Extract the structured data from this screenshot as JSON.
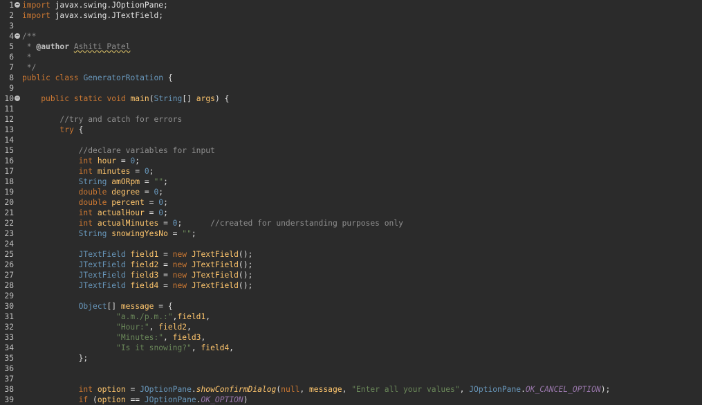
{
  "editor": {
    "folded_lines": [
      1,
      4,
      10
    ],
    "lines": [
      [
        [
          "kw",
          "import"
        ],
        [
          "txt",
          " javax.swing.JOptionPane;"
        ]
      ],
      [
        [
          "kw",
          "import"
        ],
        [
          "txt",
          " javax.swing.JTextField;"
        ]
      ],
      [],
      [
        [
          "cm",
          "/**"
        ]
      ],
      [
        [
          "cm",
          " * "
        ],
        [
          "tag",
          "@author"
        ],
        [
          "cm",
          " "
        ],
        [
          "auth",
          "Ashiti Patel"
        ]
      ],
      [
        [
          "cm",
          " *"
        ]
      ],
      [
        [
          "cm",
          " */"
        ]
      ],
      [
        [
          "kw",
          "public"
        ],
        [
          "txt",
          " "
        ],
        [
          "kw",
          "class"
        ],
        [
          "txt",
          " "
        ],
        [
          "cls",
          "GeneratorRotation"
        ],
        [
          "op",
          " {"
        ]
      ],
      [],
      [
        [
          "txt",
          "    "
        ],
        [
          "kw",
          "public"
        ],
        [
          "txt",
          " "
        ],
        [
          "kw",
          "static"
        ],
        [
          "txt",
          " "
        ],
        [
          "kw",
          "void"
        ],
        [
          "txt",
          " "
        ],
        [
          "id",
          "main"
        ],
        [
          "op",
          "("
        ],
        [
          "ty",
          "String"
        ],
        [
          "op",
          "[] "
        ],
        [
          "id",
          "args"
        ],
        [
          "op",
          ") {"
        ]
      ],
      [],
      [
        [
          "txt",
          "        "
        ],
        [
          "cm",
          "//try and catch for errors"
        ]
      ],
      [
        [
          "txt",
          "        "
        ],
        [
          "kw",
          "try"
        ],
        [
          "op",
          " {"
        ]
      ],
      [],
      [
        [
          "txt",
          "            "
        ],
        [
          "cm",
          "//declare variables for input"
        ]
      ],
      [
        [
          "txt",
          "            "
        ],
        [
          "kw",
          "int"
        ],
        [
          "txt",
          " "
        ],
        [
          "id",
          "hour"
        ],
        [
          "op",
          " = "
        ],
        [
          "num",
          "0"
        ],
        [
          "op",
          ";"
        ]
      ],
      [
        [
          "txt",
          "            "
        ],
        [
          "kw",
          "int"
        ],
        [
          "txt",
          " "
        ],
        [
          "id",
          "minutes"
        ],
        [
          "op",
          " = "
        ],
        [
          "num",
          "0"
        ],
        [
          "op",
          ";"
        ]
      ],
      [
        [
          "txt",
          "            "
        ],
        [
          "ty",
          "String"
        ],
        [
          "txt",
          " "
        ],
        [
          "id",
          "amORpm"
        ],
        [
          "op",
          " = "
        ],
        [
          "str",
          "\"\""
        ],
        [
          "op",
          ";"
        ]
      ],
      [
        [
          "txt",
          "            "
        ],
        [
          "kw",
          "double"
        ],
        [
          "txt",
          " "
        ],
        [
          "id",
          "degree"
        ],
        [
          "op",
          " = "
        ],
        [
          "num",
          "0"
        ],
        [
          "op",
          ";"
        ]
      ],
      [
        [
          "txt",
          "            "
        ],
        [
          "kw",
          "double"
        ],
        [
          "txt",
          " "
        ],
        [
          "id",
          "percent"
        ],
        [
          "op",
          " = "
        ],
        [
          "num",
          "0"
        ],
        [
          "op",
          ";"
        ]
      ],
      [
        [
          "txt",
          "            "
        ],
        [
          "kw",
          "int"
        ],
        [
          "txt",
          " "
        ],
        [
          "id",
          "actualHour"
        ],
        [
          "op",
          " = "
        ],
        [
          "num",
          "0"
        ],
        [
          "op",
          ";"
        ]
      ],
      [
        [
          "txt",
          "            "
        ],
        [
          "kw",
          "int"
        ],
        [
          "txt",
          " "
        ],
        [
          "id",
          "actualMinutes"
        ],
        [
          "op",
          " = "
        ],
        [
          "num",
          "0"
        ],
        [
          "op",
          ";"
        ],
        [
          "txt",
          "      "
        ],
        [
          "cm",
          "//created for understanding purposes only"
        ]
      ],
      [
        [
          "txt",
          "            "
        ],
        [
          "ty",
          "String"
        ],
        [
          "txt",
          " "
        ],
        [
          "id",
          "snowingYesNo"
        ],
        [
          "op",
          " = "
        ],
        [
          "str",
          "\"\""
        ],
        [
          "op",
          ";"
        ]
      ],
      [],
      [
        [
          "txt",
          "            "
        ],
        [
          "ty",
          "JTextField"
        ],
        [
          "txt",
          " "
        ],
        [
          "id",
          "field1"
        ],
        [
          "op",
          " = "
        ],
        [
          "kw",
          "new"
        ],
        [
          "txt",
          " "
        ],
        [
          "id",
          "JTextField"
        ],
        [
          "op",
          "();"
        ]
      ],
      [
        [
          "txt",
          "            "
        ],
        [
          "ty",
          "JTextField"
        ],
        [
          "txt",
          " "
        ],
        [
          "id",
          "field2"
        ],
        [
          "op",
          " = "
        ],
        [
          "kw",
          "new"
        ],
        [
          "txt",
          " "
        ],
        [
          "id",
          "JTextField"
        ],
        [
          "op",
          "();"
        ]
      ],
      [
        [
          "txt",
          "            "
        ],
        [
          "ty",
          "JTextField"
        ],
        [
          "txt",
          " "
        ],
        [
          "id",
          "field3"
        ],
        [
          "op",
          " = "
        ],
        [
          "kw",
          "new"
        ],
        [
          "txt",
          " "
        ],
        [
          "id",
          "JTextField"
        ],
        [
          "op",
          "();"
        ]
      ],
      [
        [
          "txt",
          "            "
        ],
        [
          "ty",
          "JTextField"
        ],
        [
          "txt",
          " "
        ],
        [
          "id",
          "field4"
        ],
        [
          "op",
          " = "
        ],
        [
          "kw",
          "new"
        ],
        [
          "txt",
          " "
        ],
        [
          "id",
          "JTextField"
        ],
        [
          "op",
          "();"
        ]
      ],
      [],
      [
        [
          "txt",
          "            "
        ],
        [
          "ty",
          "Object"
        ],
        [
          "op",
          "[] "
        ],
        [
          "id",
          "message"
        ],
        [
          "op",
          " = {"
        ]
      ],
      [
        [
          "txt",
          "                    "
        ],
        [
          "str",
          "\"a.m./p.m.:\""
        ],
        [
          "op",
          ","
        ],
        [
          "id",
          "field1"
        ],
        [
          "op",
          ","
        ]
      ],
      [
        [
          "txt",
          "                    "
        ],
        [
          "str",
          "\"Hour:\""
        ],
        [
          "op",
          ", "
        ],
        [
          "id",
          "field2"
        ],
        [
          "op",
          ","
        ]
      ],
      [
        [
          "txt",
          "                    "
        ],
        [
          "str",
          "\"Minutes:\""
        ],
        [
          "op",
          ", "
        ],
        [
          "id",
          "field3"
        ],
        [
          "op",
          ","
        ]
      ],
      [
        [
          "txt",
          "                    "
        ],
        [
          "str",
          "\"Is it snowing?\""
        ],
        [
          "op",
          ", "
        ],
        [
          "id",
          "field4"
        ],
        [
          "op",
          ","
        ]
      ],
      [
        [
          "txt",
          "            "
        ],
        [
          "op",
          "};"
        ]
      ],
      [],
      [],
      [
        [
          "txt",
          "            "
        ],
        [
          "kw",
          "int"
        ],
        [
          "txt",
          " "
        ],
        [
          "id",
          "option"
        ],
        [
          "op",
          " = "
        ],
        [
          "ty",
          "JOptionPane"
        ],
        [
          "op",
          "."
        ],
        [
          "mth",
          "showConfirmDialog"
        ],
        [
          "op",
          "("
        ],
        [
          "kw",
          "null"
        ],
        [
          "op",
          ", "
        ],
        [
          "id",
          "message"
        ],
        [
          "op",
          ", "
        ],
        [
          "str",
          "\"Enter all your values\""
        ],
        [
          "op",
          ", "
        ],
        [
          "ty",
          "JOptionPane"
        ],
        [
          "op",
          "."
        ],
        [
          "fld",
          "OK_CANCEL_OPTION"
        ],
        [
          "op",
          ");"
        ]
      ],
      [
        [
          "txt",
          "            "
        ],
        [
          "kw",
          "if"
        ],
        [
          "op",
          " ("
        ],
        [
          "id",
          "option"
        ],
        [
          "op",
          " == "
        ],
        [
          "ty",
          "JOptionPane"
        ],
        [
          "op",
          "."
        ],
        [
          "fld",
          "OK_OPTION"
        ],
        [
          "op",
          ")"
        ]
      ]
    ]
  }
}
